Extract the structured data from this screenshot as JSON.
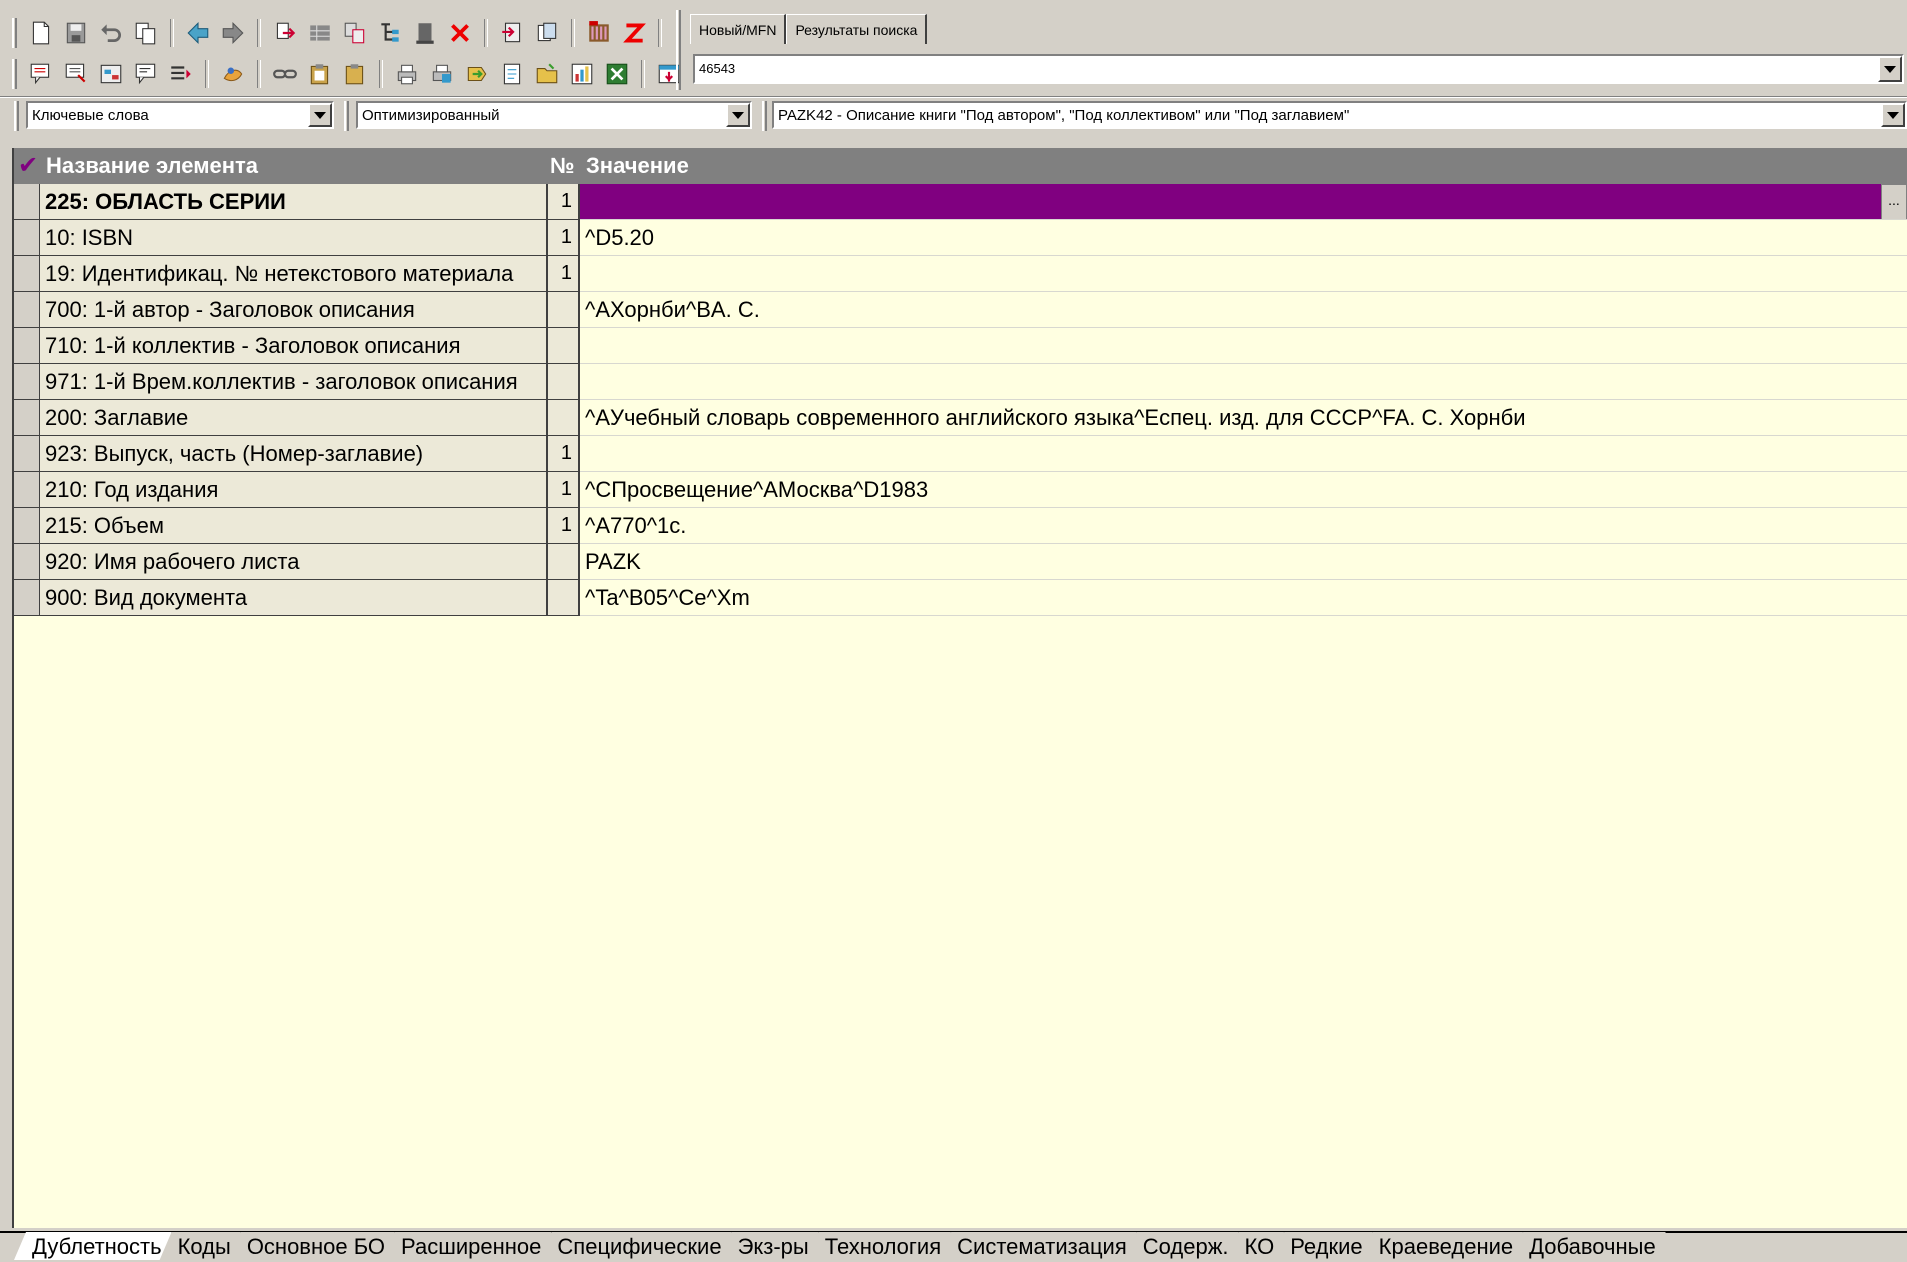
{
  "top_tabs": [
    "Новый/MFN",
    "Результаты поиска"
  ],
  "mfn_value": "46543",
  "filters": {
    "search_mode": "Ключевые слова",
    "view_mode": "Оптимизированный",
    "worksheet": "PAZK42 - Описание книги \"Под автором\", \"Под коллективом\" или \"Под заглавием\""
  },
  "grid": {
    "header": {
      "check": "✔",
      "name": "Название элемента",
      "num": "№",
      "value": "Значение"
    },
    "rows": [
      {
        "name": "225: ОБЛАСТЬ СЕРИИ",
        "num": "1",
        "value": "",
        "bold": true,
        "selected": true
      },
      {
        "name": "10: ISBN",
        "num": "1",
        "value": "^D5.20"
      },
      {
        "name": "19: Идентификац. № нетекстового материала",
        "num": "1",
        "value": ""
      },
      {
        "name": "700: 1-й  автор - Заголовок описания",
        "num": "",
        "value": "^AХорнби^BA. C."
      },
      {
        "name": "710: 1-й коллектив - Заголовок описания",
        "num": "",
        "value": ""
      },
      {
        "name": "971: 1-й Врем.коллектив - заголовок описания",
        "num": "",
        "value": ""
      },
      {
        "name": "200: Заглавие",
        "num": "",
        "value": "^AУчебный словарь современного английского языка^Eспец. изд. для СССР^FA. C. Хорнби"
      },
      {
        "name": "923: Выпуск, часть (Номер-заглавие)",
        "num": "1",
        "value": ""
      },
      {
        "name": "210: Год издания",
        "num": "1",
        "value": "^CПросвещение^AМосква^D1983"
      },
      {
        "name": "215: Объем",
        "num": "1",
        "value": "^A770^1c."
      },
      {
        "name": "920: Имя рабочего листа",
        "num": "",
        "value": "PAZK"
      },
      {
        "name": "900: Вид документа",
        "num": "",
        "value": "^Ta^B05^Ce^Xm"
      }
    ],
    "ellipsis": "..."
  },
  "bottom_tabs": [
    "Дублетность",
    "Коды",
    "Основное БО",
    "Расширенное",
    "Специфические",
    "Экз-ры",
    "Технология",
    "Систематизация",
    "Содерж.",
    "КО",
    "Редкие",
    "Краеведение",
    "Добавочные"
  ],
  "active_bottom_tab": "Дублетность",
  "colors": {
    "selected_row": "#800080",
    "grid_bg": "#ffffe1",
    "header_bg": "#808080",
    "face": "#d4d0c8"
  },
  "toolbar_icons_row1": [
    "new-icon",
    "save-icon",
    "undo-icon",
    "copy-record-icon",
    "prev-icon",
    "next-icon",
    "export-icon",
    "grid-icon",
    "transfer-icon",
    "tree-icon",
    "stamp-icon",
    "delete-icon",
    "import-icon",
    "duplicate-icon",
    "library-icon",
    "z3950-icon"
  ],
  "toolbar_icons_row2": [
    "bulletin-icon",
    "bulletin2-icon",
    "form-icon",
    "chat-icon",
    "list-icon",
    "hand-icon",
    "link-icon",
    "clip-icon",
    "paste-icon",
    "print-icon",
    "print2-icon",
    "forward-icon",
    "doc-icon",
    "folder-icon",
    "chart-icon",
    "excel-icon",
    "settings-icon"
  ]
}
